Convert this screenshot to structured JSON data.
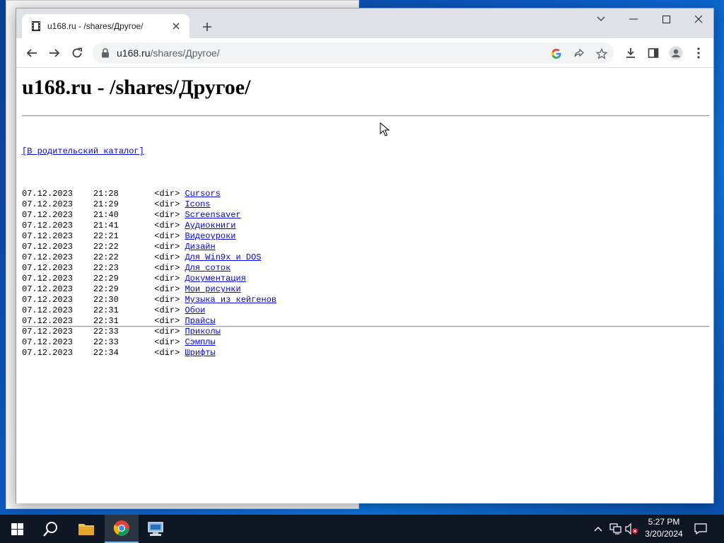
{
  "browser": {
    "tab_title": "u168.ru - /shares/Другое/",
    "address_host": "u168.ru",
    "address_path": "/shares/Другое/"
  },
  "page": {
    "heading": "u168.ru - /shares/Другое/",
    "parent_link": "[В родительский каталог]",
    "entries": [
      {
        "date": "07.12.2023",
        "time": "21:28",
        "type": "<dir>",
        "name": "Cursors"
      },
      {
        "date": "07.12.2023",
        "time": "21:29",
        "type": "<dir>",
        "name": "Icons"
      },
      {
        "date": "07.12.2023",
        "time": "21:40",
        "type": "<dir>",
        "name": "Screensaver"
      },
      {
        "date": "07.12.2023",
        "time": "21:41",
        "type": "<dir>",
        "name": "Аудиокниги"
      },
      {
        "date": "07.12.2023",
        "time": "22:21",
        "type": "<dir>",
        "name": "Видеоуроки"
      },
      {
        "date": "07.12.2023",
        "time": "22:22",
        "type": "<dir>",
        "name": "Дизайн"
      },
      {
        "date": "07.12.2023",
        "time": "22:22",
        "type": "<dir>",
        "name": "Для Win9x и DOS"
      },
      {
        "date": "07.12.2023",
        "time": "22:23",
        "type": "<dir>",
        "name": "Для соток"
      },
      {
        "date": "07.12.2023",
        "time": "22:29",
        "type": "<dir>",
        "name": "Документация"
      },
      {
        "date": "07.12.2023",
        "time": "22:29",
        "type": "<dir>",
        "name": "Мои рисунки"
      },
      {
        "date": "07.12.2023",
        "time": "22:30",
        "type": "<dir>",
        "name": "Музыка из кейгенов"
      },
      {
        "date": "07.12.2023",
        "time": "22:31",
        "type": "<dir>",
        "name": "Обои"
      },
      {
        "date": "07.12.2023",
        "time": "22:31",
        "type": "<dir>",
        "name": "Прайсы"
      },
      {
        "date": "07.12.2023",
        "time": "22:33",
        "type": "<dir>",
        "name": "Приколы"
      },
      {
        "date": "07.12.2023",
        "time": "22:33",
        "type": "<dir>",
        "name": "Сэмплы"
      },
      {
        "date": "07.12.2023",
        "time": "22:34",
        "type": "<dir>",
        "name": "Шрифты"
      }
    ]
  },
  "taskbar": {
    "time": "5:27 PM",
    "date": "3/20/2024"
  },
  "colors": {
    "link": "#0000ee",
    "taskbar": "#0f1724",
    "tab_strip": "#dee1e6"
  },
  "icons": [
    "film-icon",
    "close-icon",
    "plus-icon",
    "chevron-down-icon",
    "minimize-icon",
    "maximize-icon",
    "back-arrow-icon",
    "forward-arrow-icon",
    "reload-icon",
    "lock-icon",
    "google-icon",
    "share-icon",
    "star-icon",
    "download-icon",
    "side-panel-icon",
    "profile-icon",
    "menu-icon",
    "windows-start-icon",
    "search-icon",
    "file-explorer-icon",
    "chrome-icon",
    "network-app-icon",
    "tray-chevron-icon",
    "network-icon",
    "volume-muted-icon",
    "notifications-icon"
  ]
}
